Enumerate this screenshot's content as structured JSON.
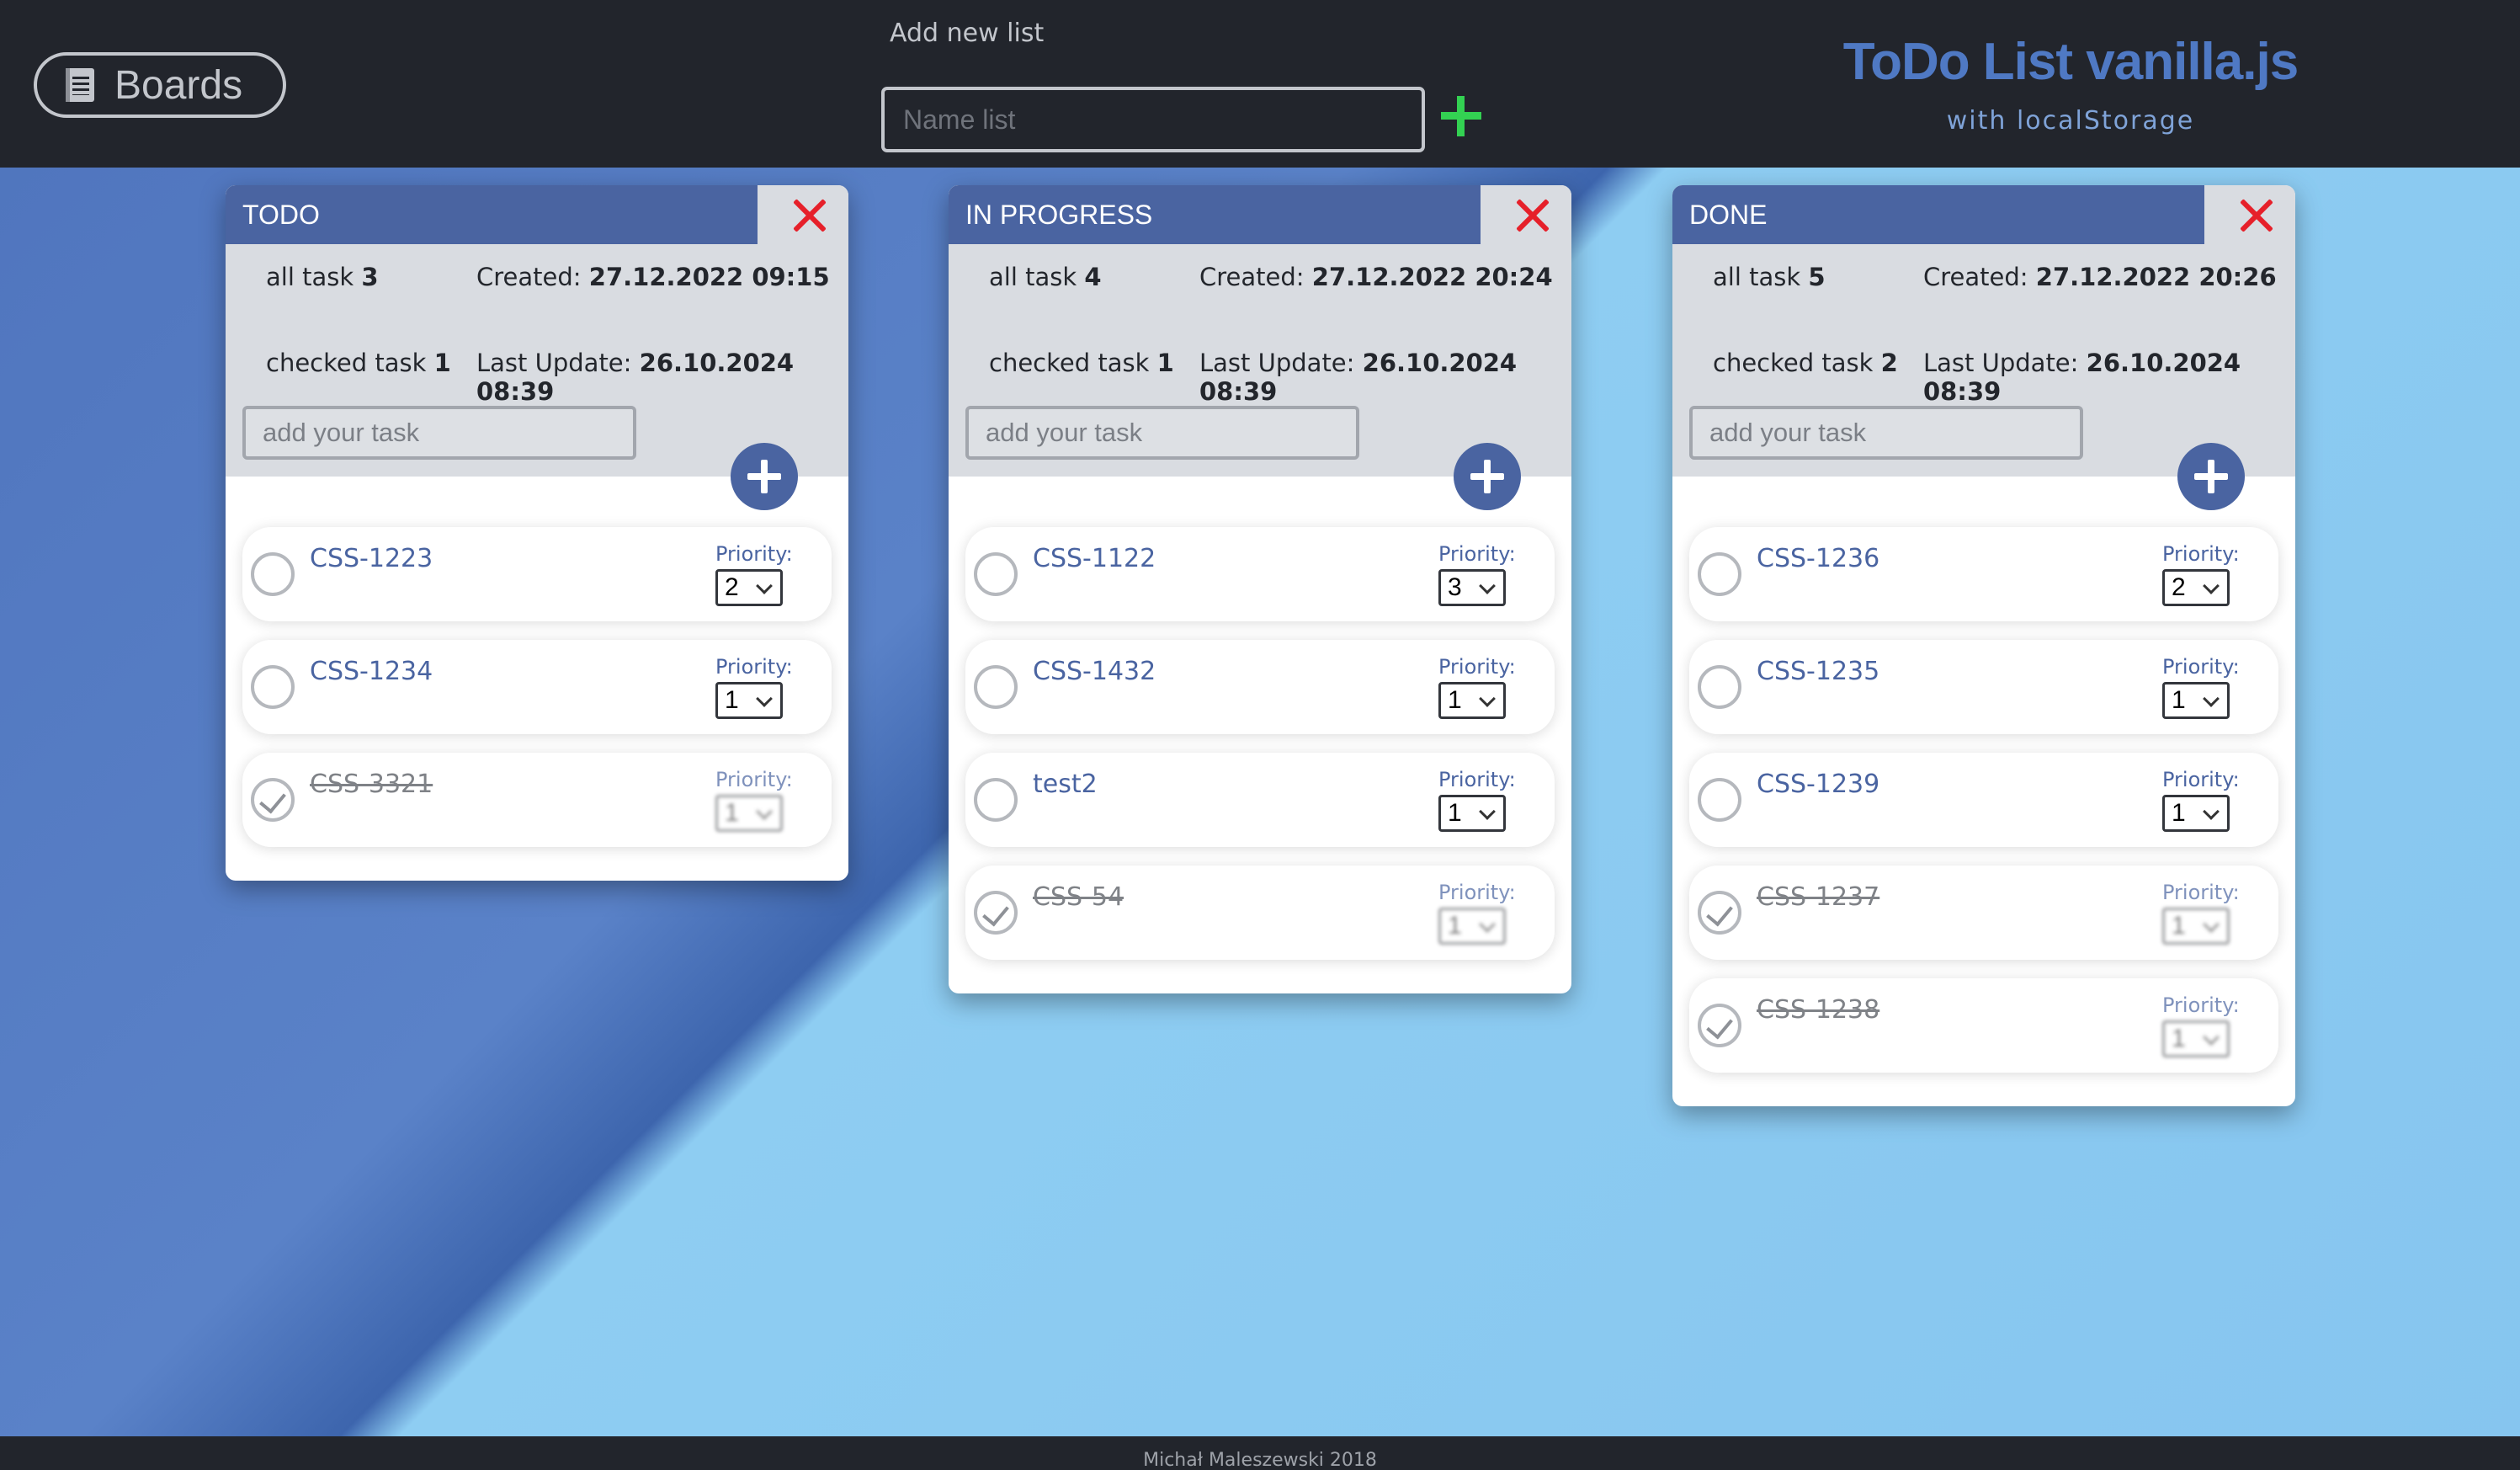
{
  "header": {
    "boards_label": "Boards",
    "newlist_label": "Add new list",
    "newlist_placeholder": "Name list",
    "title": "ToDo List vanilla.js",
    "subtitle": "with localStorage"
  },
  "labels": {
    "all_task": "all task",
    "checked_task": "checked task",
    "created": "Created:",
    "last_update": "Last Update:",
    "priority": "Priority:",
    "task_placeholder": "add your task"
  },
  "lists": [
    {
      "title": "TODO",
      "all_count": "3",
      "checked_count": "1",
      "created": "27.12.2022 09:15",
      "last_update": "26.10.2024 08:39",
      "tasks": [
        {
          "name": "CSS-1223",
          "priority": "2",
          "done": false
        },
        {
          "name": "CSS-1234",
          "priority": "1",
          "done": false
        },
        {
          "name": "CSS-3321",
          "priority": "1",
          "done": true
        }
      ]
    },
    {
      "title": "IN PROGRESS",
      "all_count": "4",
      "checked_count": "1",
      "created": "27.12.2022 20:24",
      "last_update": "26.10.2024 08:39",
      "tasks": [
        {
          "name": "CSS-1122",
          "priority": "3",
          "done": false
        },
        {
          "name": "CSS-1432",
          "priority": "1",
          "done": false
        },
        {
          "name": "test2",
          "priority": "1",
          "done": false
        },
        {
          "name": "CSS-54",
          "priority": "1",
          "done": true
        }
      ]
    },
    {
      "title": "DONE",
      "all_count": "5",
      "checked_count": "2",
      "created": "27.12.2022 20:26",
      "last_update": "26.10.2024 08:39",
      "tasks": [
        {
          "name": "CSS-1236",
          "priority": "2",
          "done": false
        },
        {
          "name": "CSS-1235",
          "priority": "1",
          "done": false
        },
        {
          "name": "CSS-1239",
          "priority": "1",
          "done": false
        },
        {
          "name": "CSS-1237",
          "priority": "1",
          "done": true
        },
        {
          "name": "CSS-1238",
          "priority": "1",
          "done": true
        }
      ]
    }
  ],
  "footer": {
    "credit": "Michał Maleszewski 2018"
  }
}
